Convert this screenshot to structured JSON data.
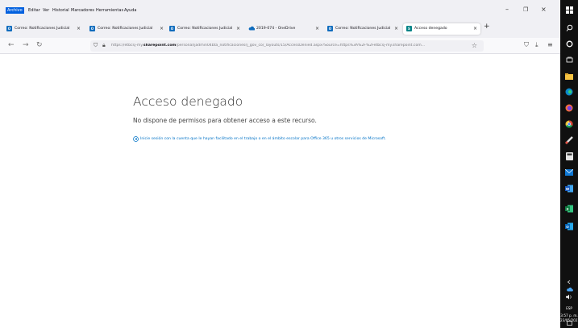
{
  "menu": {
    "items": [
      "Archivo",
      "Editar",
      "Ver",
      "Historial",
      "Marcadores",
      "Herramientas",
      "Ayuda"
    ],
    "active": "Archivo"
  },
  "tabs": [
    {
      "label": "Correo: Notificaciones Judicial",
      "icon": "outlook-icon"
    },
    {
      "label": "Correo: Notificaciones Judicial",
      "icon": "outlook-icon"
    },
    {
      "label": "Correo: Notificaciones Judicial",
      "icon": "outlook-icon"
    },
    {
      "label": "2019-074 - OneDrive",
      "icon": "onedrive-icon"
    },
    {
      "label": "Correo: Notificaciones Judicial",
      "icon": "outlook-icon"
    },
    {
      "label": "Acceso denegado",
      "icon": "sharepoint-icon",
      "active": true
    }
  ],
  "url": {
    "prefix": "https://etbcsj-my.",
    "domain": "sharepoint.com",
    "suffix": "/personal/jadmin04bta_notificacionesrj_gov_co/_layouts/15/AccessDenied.aspx?Source=https%3A%2F%2Fetbcsj-my.sharepoint.com..."
  },
  "page": {
    "title": "Acceso denegado",
    "subtitle": "No dispone de permisos para obtener acceso a este recurso.",
    "signin_link": "Inicie sesión con la cuenta que le hayan facilitado en el trabajo o en el ámbito escolar para Office 365 u otros servicios de Microsoft."
  },
  "taskbar": {
    "language": "ESP",
    "time": "3:57 p. m.",
    "date": "23/05/2023"
  },
  "colors": {
    "accent": "#0060df",
    "link": "#0072c6"
  }
}
